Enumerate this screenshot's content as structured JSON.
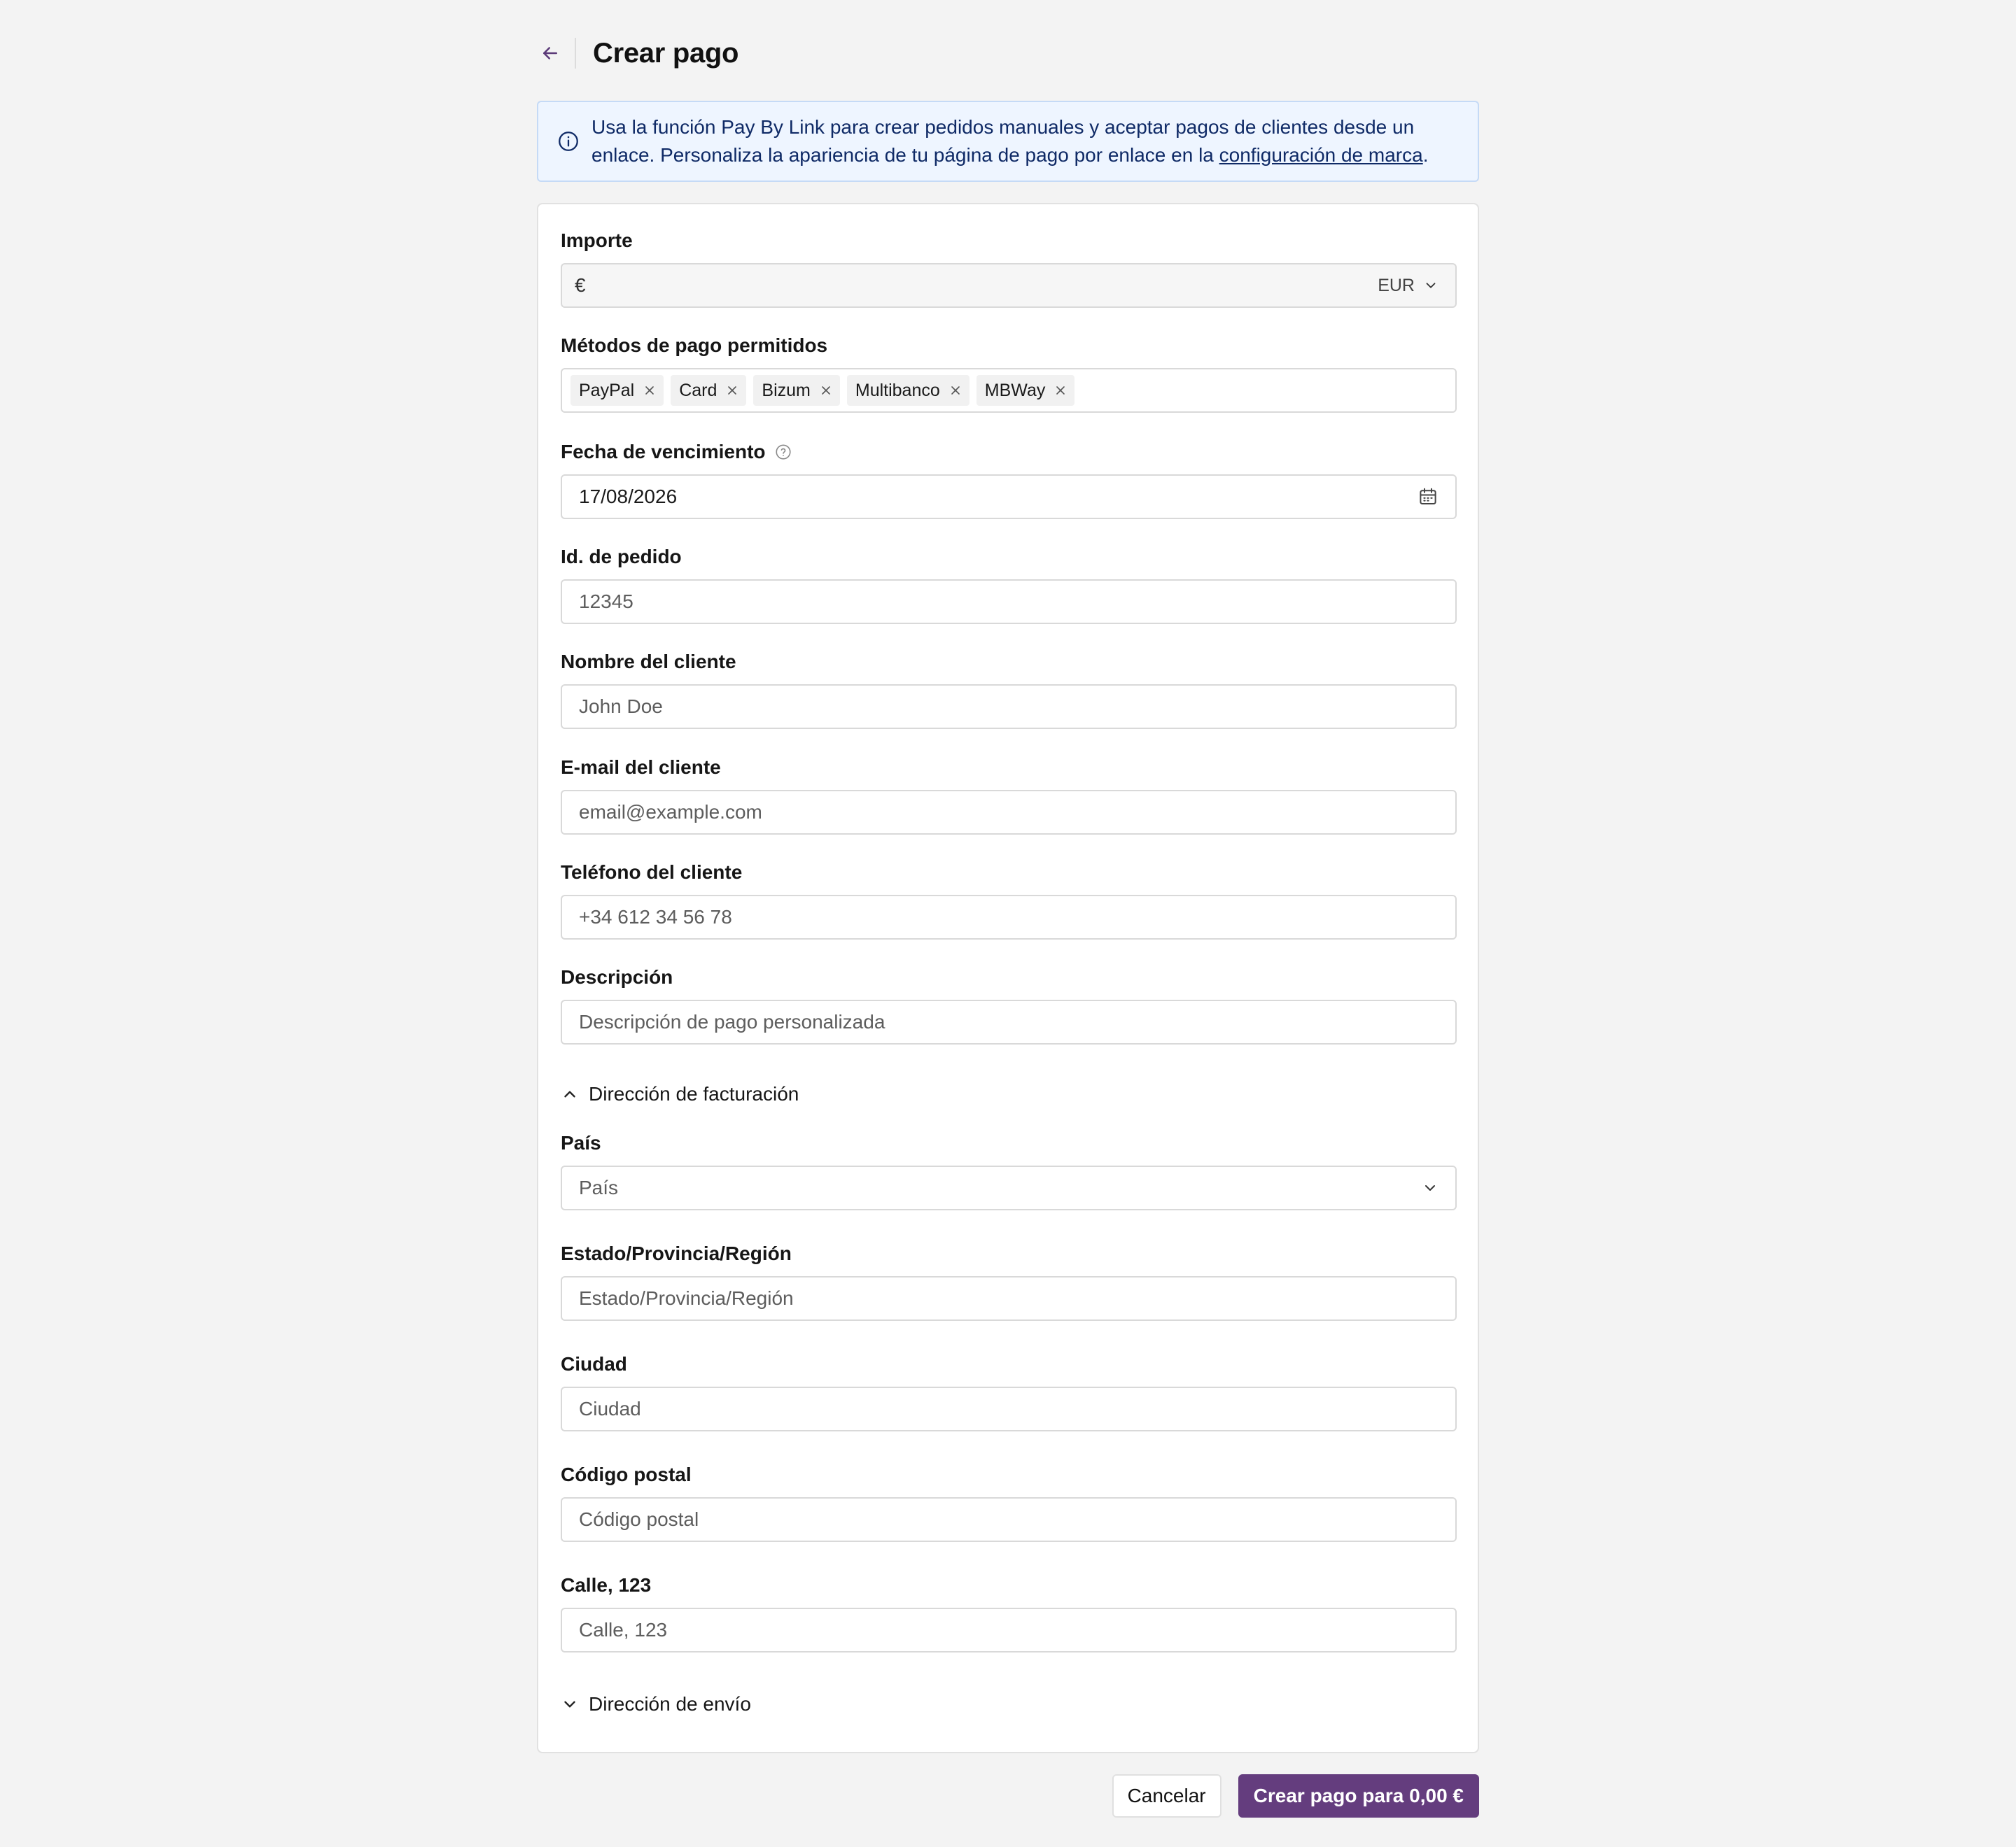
{
  "header": {
    "title": "Crear pago"
  },
  "banner": {
    "text": "Usa la función Pay By Link para crear pedidos manuales y aceptar pagos de clientes desde un enlace. Personaliza la apariencia de tu página de pago por enlace en la ",
    "link": "configuración de marca",
    "suffix": "."
  },
  "form": {
    "amount": {
      "label": "Importe",
      "symbol": "€",
      "currency": "EUR"
    },
    "methods": {
      "label": "Métodos de pago permitidos",
      "chips": [
        "PayPal",
        "Card",
        "Bizum",
        "Multibanco",
        "MBWay"
      ]
    },
    "due_date": {
      "label": "Fecha de vencimiento",
      "value": "17/08/2026"
    },
    "order_id": {
      "label": "Id. de pedido",
      "placeholder": "12345"
    },
    "customer_name": {
      "label": "Nombre del cliente",
      "placeholder": "John Doe"
    },
    "customer_email": {
      "label": "E-mail del cliente",
      "placeholder": "email@example.com"
    },
    "customer_phone": {
      "label": "Teléfono del cliente",
      "placeholder": "+34 612 34 56 78"
    },
    "description": {
      "label": "Descripción",
      "placeholder": "Descripción de pago personalizada"
    },
    "billing_toggle": "Dirección de facturación",
    "country": {
      "label": "País",
      "placeholder": "País"
    },
    "state": {
      "label": "Estado/Provincia/Región",
      "placeholder": "Estado/Provincia/Región"
    },
    "city": {
      "label": "Ciudad",
      "placeholder": "Ciudad"
    },
    "postal": {
      "label": "Código postal",
      "placeholder": "Código postal"
    },
    "street": {
      "label": "Calle, 123",
      "placeholder": "Calle, 123"
    },
    "shipping_toggle": "Dirección de envío"
  },
  "footer": {
    "cancel": "Cancelar",
    "submit": "Crear pago para 0,00 €"
  },
  "colors": {
    "primary": "#643d7e",
    "banner_bg": "#eef5ff",
    "banner_text": "#0f2a66"
  }
}
